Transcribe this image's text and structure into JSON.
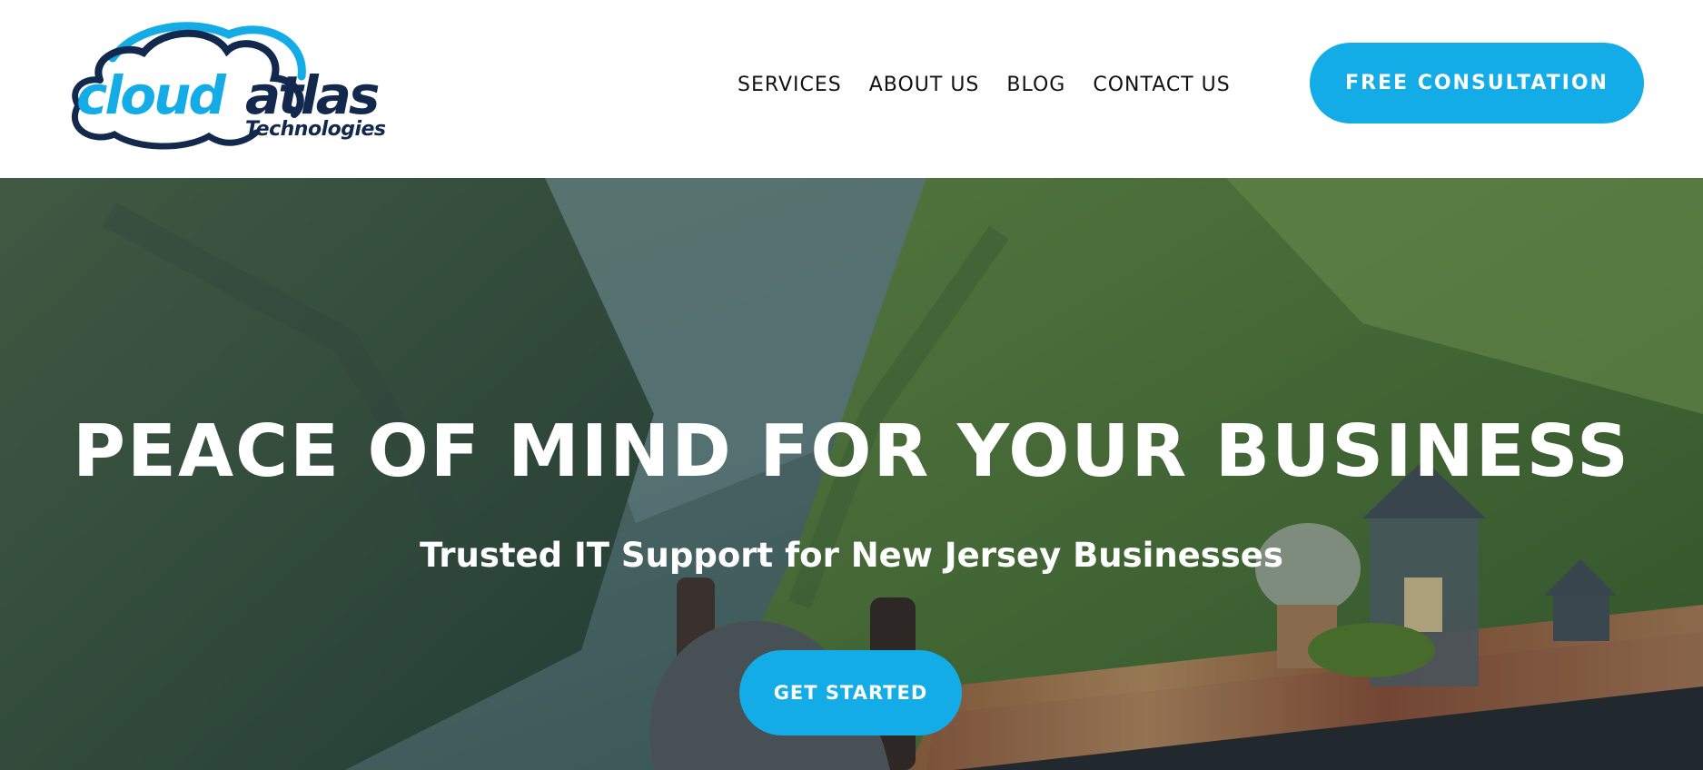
{
  "logo": {
    "word_primary": "cloud",
    "word_secondary": "atlas",
    "tagline": "Technologies",
    "brand_blue": "#13ace6",
    "brand_navy": "#12294d"
  },
  "nav": {
    "items": [
      "SERVICES",
      "ABOUT US",
      "BLOG",
      "CONTACT US"
    ]
  },
  "header_cta": {
    "label": "FREE CONSULTATION",
    "color": "#13ace6"
  },
  "hero": {
    "title": "PEACE OF MIND FOR YOUR BUSINESS",
    "subtitle": "Trusted IT Support for New Jersey Businesses",
    "cta_label": "GET STARTED"
  }
}
